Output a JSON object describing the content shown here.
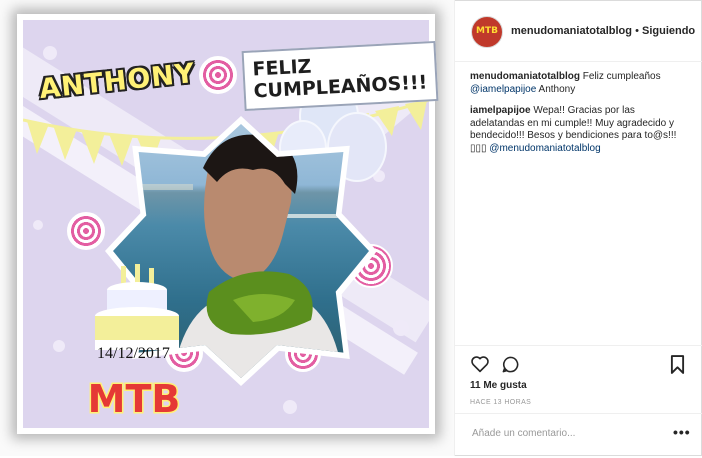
{
  "post_image": {
    "name_text": "ANTHONY",
    "greeting_text": "FELIZ CUMPLEAÑOS!!!",
    "date_text": "14/12/2017",
    "logo_text": "MTB",
    "colors": {
      "background": "#ddd5ee",
      "bunting": "#f3ef9a",
      "swirl": "#e35ea2",
      "logo": "#e53935"
    }
  },
  "header": {
    "username": "menudomaniatotalblog",
    "separator": "•",
    "follow_status": "Siguiendo",
    "avatar_text": "MTB"
  },
  "comments": [
    {
      "user": "menudomaniatotalblog",
      "text": " Feliz cumpleaños ",
      "mention": "@iamelpapijoe",
      "text_after": " Anthony"
    },
    {
      "user": "iamelpapijoe",
      "text": " Wepa!! Gracias por las adelatandas en mi cumple!! Muy agradecido y bendecido!!! Besos y bendiciones para to@s!!! ▯▯▯ ",
      "mention": "@menudomaniatotalblog",
      "text_after": ""
    }
  ],
  "actions": {
    "like_icon": "heart-icon",
    "comment_icon": "comment-icon",
    "save_icon": "bookmark-icon",
    "likes_text": "11 Me gusta",
    "time_text": "HACE 13 HORAS"
  },
  "add_comment": {
    "placeholder": "Añade un comentario...",
    "more_label": "•••"
  }
}
